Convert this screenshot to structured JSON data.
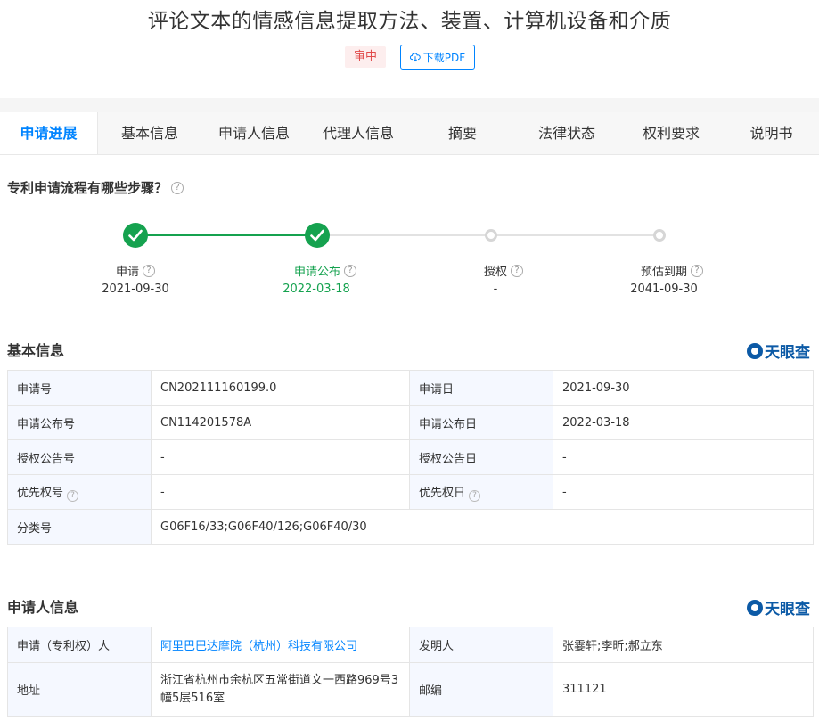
{
  "header": {
    "title": "评论文本的情感信息提取方法、装置、计算机设备和介质",
    "status": "审中",
    "download_label": "下载PDF"
  },
  "tabs": [
    {
      "label": "申请进展",
      "active": true
    },
    {
      "label": "基本信息"
    },
    {
      "label": "申请人信息"
    },
    {
      "label": "代理人信息"
    },
    {
      "label": "摘要"
    },
    {
      "label": "法律状态"
    },
    {
      "label": "权利要求"
    },
    {
      "label": "说明书"
    }
  ],
  "progress": {
    "question": "专利申请流程有哪些步骤？",
    "help_icon": "?",
    "steps": [
      {
        "label": "申请",
        "date": "2021-09-30",
        "done": true
      },
      {
        "label": "申请公布",
        "date": "2022-03-18",
        "done": true
      },
      {
        "label": "授权",
        "date": "-",
        "done": false
      },
      {
        "label": "预估到期",
        "date": "2041-09-30",
        "done": false
      }
    ],
    "done_color": "#15a24f",
    "pending_color": "#d6d6d6"
  },
  "basic_info": {
    "title": "基本信息",
    "logo_text": "天眼查",
    "rows": [
      {
        "l1": "申请号",
        "v1": "CN202111160199.0",
        "l2": "申请日",
        "v2": "2021-09-30"
      },
      {
        "l1": "申请公布号",
        "v1": "CN114201578A",
        "l2": "申请公布日",
        "v2": "2022-03-18"
      },
      {
        "l1": "授权公告号",
        "v1": "-",
        "l2": "授权公告日",
        "v2": "-"
      },
      {
        "l1": "优先权号",
        "v1": "-",
        "l2": "优先权日",
        "v2": "-"
      },
      {
        "l1": "分类号",
        "v1": "G06F16/33;G06F40/126;G06F40/30"
      }
    ]
  },
  "applicant_info": {
    "title": "申请人信息",
    "logo_text": "天眼查",
    "applicant_label": "申请（专利权）人",
    "applicant_value": "阿里巴巴达摩院（杭州）科技有限公司",
    "inventor_label": "发明人",
    "inventor_value": "张霎轩;李昕;郝立东",
    "address_label": "地址",
    "address_value": "浙江省杭州市余杭区五常街道文一西路969号3幢5层516室",
    "zip_label": "邮编",
    "zip_value": "311121"
  },
  "colors": {
    "accent": "#0084ff",
    "brand": "#0c5aa6",
    "status_red": "#e14b4b"
  }
}
